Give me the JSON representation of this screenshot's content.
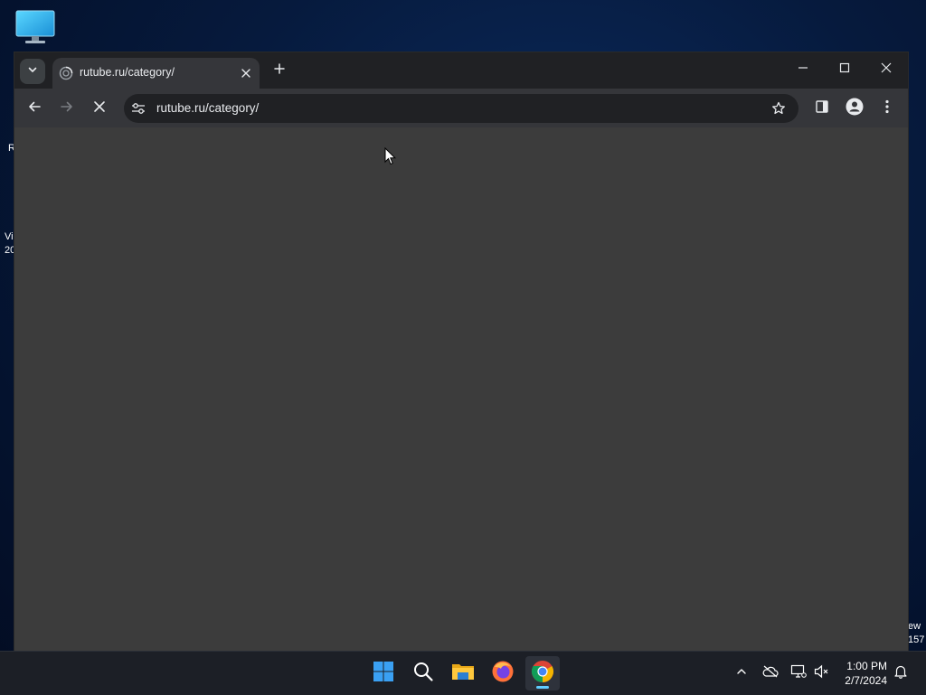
{
  "desktop": {
    "icon": "this-pc-monitor-icon",
    "left_edge_fragments": [
      "R",
      "Vi",
      "20"
    ],
    "right_edge_fragments": [
      "ew",
      "157"
    ]
  },
  "browser": {
    "tab": {
      "title": "rutube.ru/category/",
      "favicon": "loading-globe-icon"
    },
    "omnibox": {
      "url": "rutube.ru/category/"
    },
    "icons": {
      "tab_search": "chevron-down-icon",
      "tab_close": "close-icon",
      "new_tab": "plus-icon",
      "minimize": "minimize-icon",
      "maximize": "maximize-icon",
      "close_window": "close-icon",
      "back": "back-arrow-icon",
      "forward": "forward-arrow-icon",
      "stop": "stop-loading-icon",
      "site_info": "tune-icon",
      "bookmark": "star-outline-icon",
      "side_panel": "side-panel-icon",
      "profile": "profile-icon",
      "menu": "kebab-menu-icon"
    },
    "colors": {
      "titlebar": "#202124",
      "toolbar": "#35363a",
      "content": "#3c3c3c"
    }
  },
  "taskbar": {
    "apps": [
      {
        "name": "Start",
        "icon": "windows-start-icon"
      },
      {
        "name": "Search",
        "icon": "search-icon"
      },
      {
        "name": "File Explorer",
        "icon": "folder-icon"
      },
      {
        "name": "Firefox",
        "icon": "firefox-icon"
      },
      {
        "name": "Chrome",
        "icon": "chrome-icon",
        "active": true
      }
    ],
    "tray": {
      "icons": [
        "chevron-up-icon",
        "cloud-offline-icon",
        "network-icon",
        "volume-muted-icon",
        "notification-bell-icon"
      ]
    },
    "clock": {
      "time": "1:00 PM",
      "date": "2/7/2024"
    }
  }
}
